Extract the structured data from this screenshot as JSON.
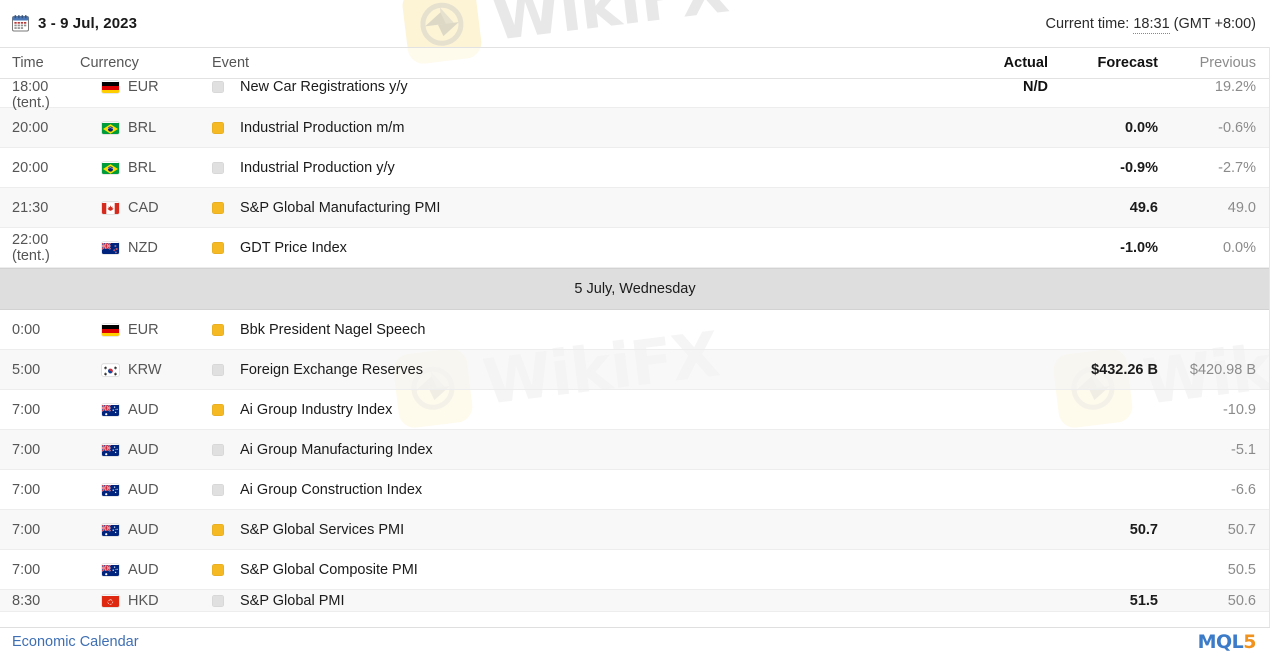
{
  "header": {
    "calendar_icon": "calendar-icon",
    "date_range": "3 - 9 Jul, 2023",
    "current_time_label": "Current time:",
    "current_time_value": "18:31",
    "timezone": "(GMT +8:00)"
  },
  "columns": {
    "time": "Time",
    "currency": "Currency",
    "event": "Event",
    "actual": "Actual",
    "forecast": "Forecast",
    "previous": "Previous"
  },
  "colors": {
    "importance_medium": "#f5b924",
    "importance_low": "#e0e0e0",
    "link": "#3e6fb4",
    "logo_blue": "#3b7bc8",
    "logo_orange": "#f0921e",
    "day_separator_bg": "#dedede"
  },
  "rows": [
    {
      "time": "18:00",
      "time_sub": "(tent.)",
      "currency": "EUR",
      "flag": "flag-germany",
      "importance": "low",
      "event": "New Car Registrations y/y",
      "actual": "N/D",
      "forecast": "",
      "previous": "19.2%",
      "shade": "plain",
      "clipped_top": true
    },
    {
      "time": "20:00",
      "time_sub": "",
      "currency": "BRL",
      "flag": "flag-brazil",
      "importance": "med",
      "event": "Industrial Production m/m",
      "actual": "",
      "forecast": "0.0%",
      "previous": "-0.6%",
      "shade": "alt"
    },
    {
      "time": "20:00",
      "time_sub": "",
      "currency": "BRL",
      "flag": "flag-brazil",
      "importance": "low",
      "event": "Industrial Production y/y",
      "actual": "",
      "forecast": "-0.9%",
      "previous": "-2.7%",
      "shade": "plain"
    },
    {
      "time": "21:30",
      "time_sub": "",
      "currency": "CAD",
      "flag": "flag-canada",
      "importance": "med",
      "event": "S&P Global Manufacturing PMI",
      "actual": "",
      "forecast": "49.6",
      "previous": "49.0",
      "shade": "alt"
    },
    {
      "time": "22:00",
      "time_sub": "(tent.)",
      "currency": "NZD",
      "flag": "flag-newzealand",
      "importance": "med",
      "event": "GDT Price Index",
      "actual": "",
      "forecast": "-1.0%",
      "previous": "0.0%",
      "shade": "plain"
    },
    {
      "time": "0:00",
      "time_sub": "",
      "currency": "EUR",
      "flag": "flag-germany",
      "importance": "med",
      "event": "Bbk President Nagel Speech",
      "actual": "",
      "forecast": "",
      "previous": "",
      "shade": "plain"
    },
    {
      "time": "5:00",
      "time_sub": "",
      "currency": "KRW",
      "flag": "flag-southkorea",
      "importance": "low",
      "event": "Foreign Exchange Reserves",
      "actual": "",
      "forecast": "$432.26 B",
      "previous": "$420.98 B",
      "shade": "alt"
    },
    {
      "time": "7:00",
      "time_sub": "",
      "currency": "AUD",
      "flag": "flag-australia",
      "importance": "med",
      "event": "Ai Group Industry Index",
      "actual": "",
      "forecast": "",
      "previous": "-10.9",
      "shade": "plain"
    },
    {
      "time": "7:00",
      "time_sub": "",
      "currency": "AUD",
      "flag": "flag-australia",
      "importance": "low",
      "event": "Ai Group Manufacturing Index",
      "actual": "",
      "forecast": "",
      "previous": "-5.1",
      "shade": "alt"
    },
    {
      "time": "7:00",
      "time_sub": "",
      "currency": "AUD",
      "flag": "flag-australia",
      "importance": "low",
      "event": "Ai Group Construction Index",
      "actual": "",
      "forecast": "",
      "previous": "-6.6",
      "shade": "plain"
    },
    {
      "time": "7:00",
      "time_sub": "",
      "currency": "AUD",
      "flag": "flag-australia",
      "importance": "med",
      "event": "S&P Global Services PMI",
      "actual": "",
      "forecast": "50.7",
      "previous": "50.7",
      "shade": "alt"
    },
    {
      "time": "7:00",
      "time_sub": "",
      "currency": "AUD",
      "flag": "flag-australia",
      "importance": "med",
      "event": "S&P Global Composite PMI",
      "actual": "",
      "forecast": "",
      "previous": "50.5",
      "shade": "plain"
    },
    {
      "time": "8:30",
      "time_sub": "",
      "currency": "HKD",
      "flag": "flag-hongkong",
      "importance": "low",
      "event": "S&P Global PMI",
      "actual": "",
      "forecast": "51.5",
      "previous": "50.6",
      "shade": "alt",
      "clipped_bottom": true
    }
  ],
  "day_separator": {
    "after_row_index": 4,
    "label": "5 July, Wednesday"
  },
  "watermark": {
    "text": "WikiFX"
  },
  "footer": {
    "link": "Economic Calendar",
    "logo_main": "MQL",
    "logo_accent": "5"
  }
}
